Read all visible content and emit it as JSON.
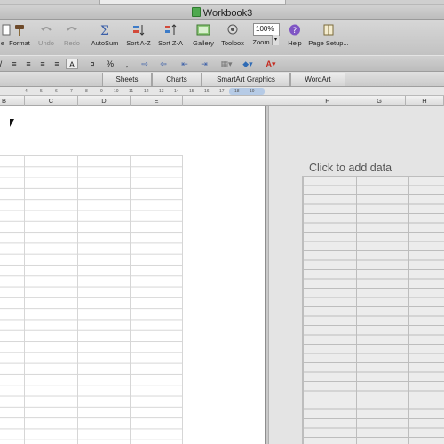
{
  "window": {
    "title": "Workbook3"
  },
  "toolbar": {
    "buttons": [
      {
        "label": "e",
        "icon": "new-icon"
      },
      {
        "label": "Format",
        "icon": "format-painter-icon"
      },
      {
        "label": "Undo",
        "icon": "undo-icon",
        "enabled": false
      },
      {
        "label": "Redo",
        "icon": "redo-icon",
        "enabled": false
      },
      {
        "label": "AutoSum",
        "icon": "sigma-icon"
      },
      {
        "label": "Sort A-Z",
        "icon": "sort-ascending-icon"
      },
      {
        "label": "Sort Z-A",
        "icon": "sort-descending-icon"
      },
      {
        "label": "Gallery",
        "icon": "gallery-icon"
      },
      {
        "label": "Toolbox",
        "icon": "toolbox-icon"
      },
      {
        "label": "Zoom",
        "icon": "zoom-icon"
      },
      {
        "label": "Help",
        "icon": "help-icon"
      },
      {
        "label": "Page Setup...",
        "icon": "page-setup-icon"
      }
    ],
    "zoom_value": "100%"
  },
  "format_bar": {
    "currency_symbol": "%",
    "number_format_symbol": "¤"
  },
  "ribbon": {
    "tabs": [
      "Sheets",
      "Charts",
      "SmartArt Graphics",
      "WordArt"
    ]
  },
  "ruler": {
    "ticks": [
      "4",
      "5",
      "6",
      "7",
      "8",
      "9",
      "10",
      "11",
      "12",
      "13",
      "14",
      "15",
      "16",
      "17",
      "18",
      "19"
    ]
  },
  "columns": {
    "left": [
      "B",
      "C",
      "D",
      "E"
    ],
    "right": [
      "F",
      "G",
      "H"
    ]
  },
  "chart_pane": {
    "placeholder": "Click to add data"
  },
  "colors": {
    "toolbar_bg": "#c8c8c8",
    "grid_line": "#d6d6d6",
    "chart_pane_bg": "#e4e4e4"
  }
}
